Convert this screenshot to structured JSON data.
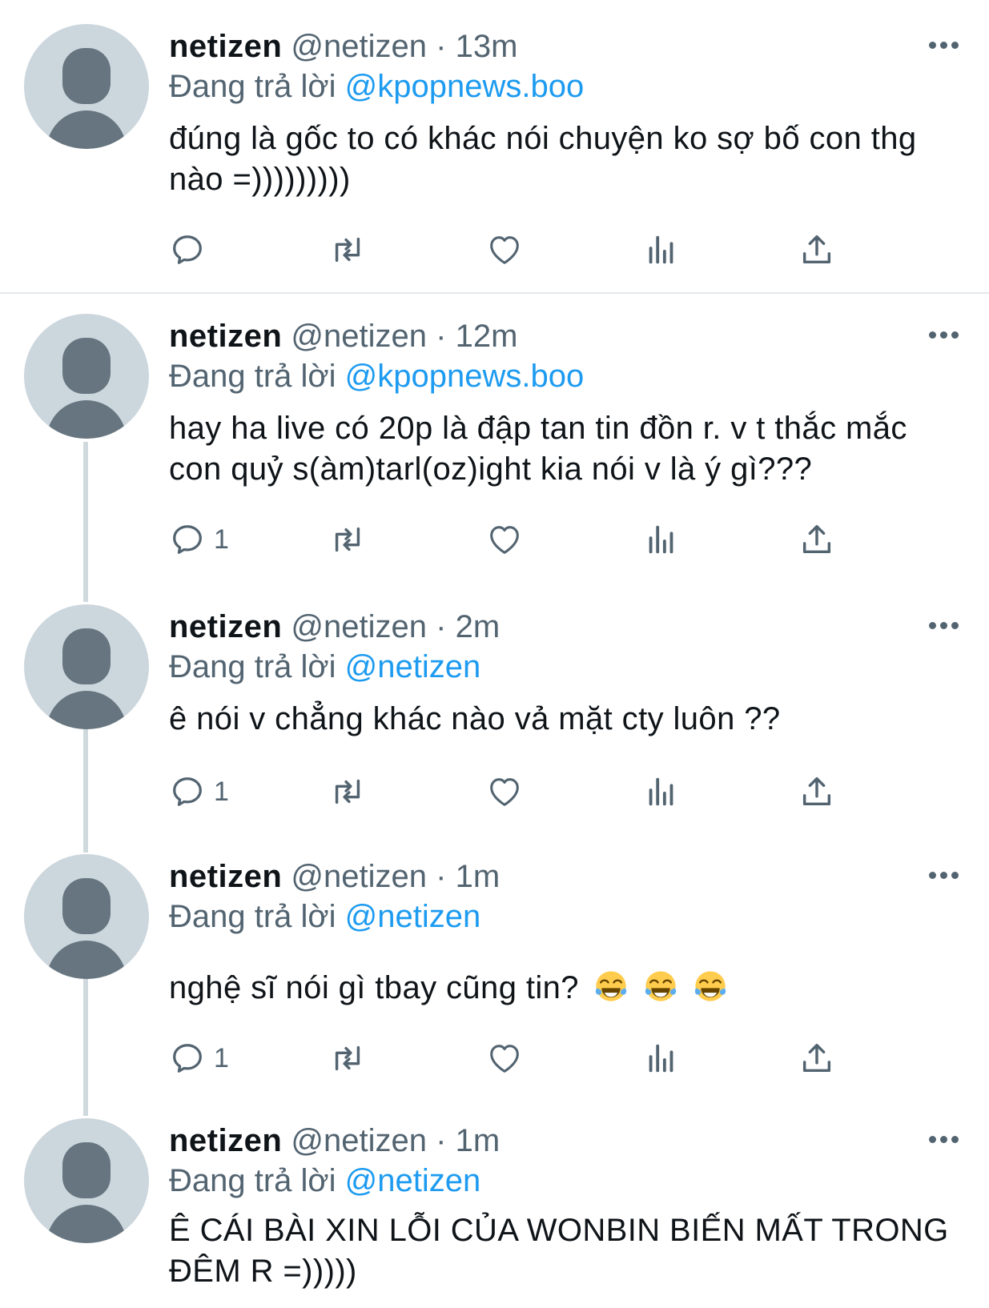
{
  "tweets": [
    {
      "name": "netizen",
      "handle": "@netizen",
      "separator": "·",
      "time": "13m",
      "reply_prefix": "Đang trả lời",
      "reply_to": "@kpopnews.boo",
      "text": "đúng là gốc to có khác nói chuyện ko sợ bố con thg nào =)))))))))",
      "reply_count": ""
    },
    {
      "name": "netizen",
      "handle": "@netizen",
      "separator": "·",
      "time": "12m",
      "reply_prefix": "Đang trả lời",
      "reply_to": "@kpopnews.boo",
      "text": "hay ha live có 20p là đập tan tin đồn r. v t thắc mắc con quỷ s(àm)tarl(oz)ight kia nói v là ý gì???",
      "reply_count": "1"
    },
    {
      "name": "netizen",
      "handle": "@netizen",
      "separator": "·",
      "time": "2m",
      "reply_prefix": "Đang trả lời",
      "reply_to": "@netizen",
      "text": "ê nói v chẳng khác nào vả mặt cty luôn ??",
      "reply_count": "1"
    },
    {
      "name": "netizen",
      "handle": "@netizen",
      "separator": "·",
      "time": "1m",
      "reply_prefix": "Đang trả lời",
      "reply_to": "@netizen",
      "text": "nghệ sĩ nói gì tbay cũng tin?",
      "emojis": [
        "face-with-tears-of-joy",
        "face-with-tears-of-joy",
        "face-with-tears-of-joy"
      ],
      "reply_count": "1"
    },
    {
      "name": "netizen",
      "handle": "@netizen",
      "separator": "·",
      "time": "1m",
      "reply_prefix": "Đang trả lời",
      "reply_to": "@netizen",
      "text": "Ê CÁI BÀI XIN LỖI CỦA WONBIN BIẾN MẤT TRONG ĐÊM R =)))))"
    }
  ],
  "icons": {
    "reply": "reply-icon",
    "retweet": "retweet-icon",
    "like": "like-icon",
    "views": "views-icon",
    "share": "share-icon",
    "more": "more-icon"
  },
  "colors": {
    "link": "#1d9bf0",
    "secondary_text": "#536471",
    "avatar_bg": "#ccd6dd",
    "avatar_fg": "#66757f",
    "thread_line": "#cfd9de"
  }
}
